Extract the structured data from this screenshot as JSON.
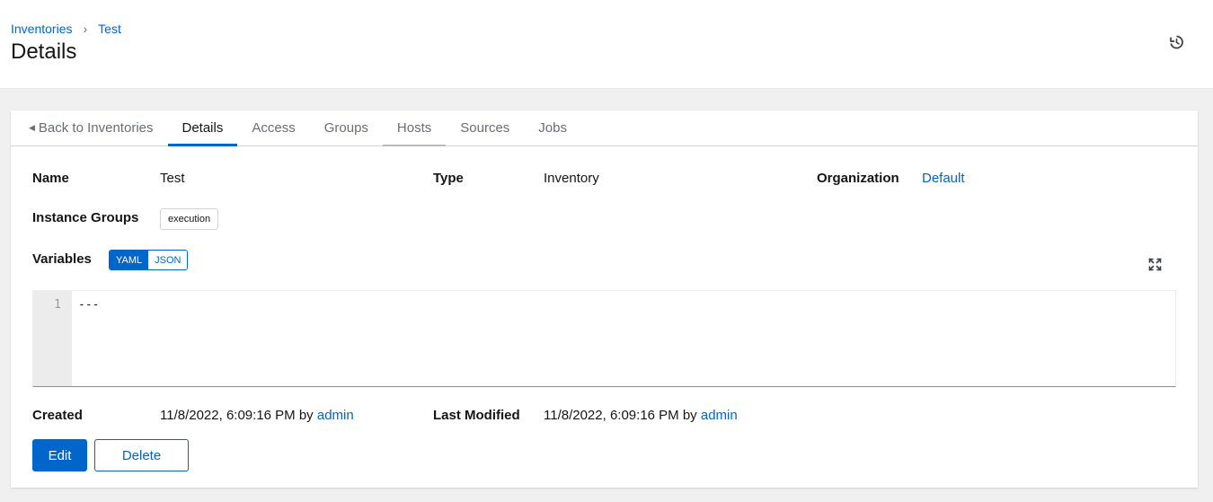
{
  "breadcrumb": {
    "parent": "Inventories",
    "current": "Test"
  },
  "page": {
    "title": "Details"
  },
  "tabs": [
    {
      "label": "Back to Inventories"
    },
    {
      "label": "Details"
    },
    {
      "label": "Access"
    },
    {
      "label": "Groups"
    },
    {
      "label": "Hosts"
    },
    {
      "label": "Sources"
    },
    {
      "label": "Jobs"
    }
  ],
  "details": {
    "name_label": "Name",
    "name_value": "Test",
    "type_label": "Type",
    "type_value": "Inventory",
    "org_label": "Organization",
    "org_value": "Default",
    "instance_groups_label": "Instance Groups",
    "instance_group_chip": "execution",
    "variables_label": "Variables",
    "toggle_yaml": "YAML",
    "toggle_json": "JSON",
    "created_label": "Created",
    "created_value": "11/8/2022, 6:09:16 PM by",
    "created_by": "admin",
    "modified_label": "Last Modified",
    "modified_value": "11/8/2022, 6:09:16 PM by",
    "modified_by": "admin"
  },
  "editor": {
    "line_number": "1",
    "content": "---"
  },
  "buttons": {
    "edit": "Edit",
    "delete": "Delete"
  },
  "icons": {
    "history": "history-icon",
    "expand": "expand-icon",
    "back": "caret-left-icon"
  },
  "colors": {
    "accent": "#0066cc",
    "page_bg": "#f0f0f0"
  }
}
